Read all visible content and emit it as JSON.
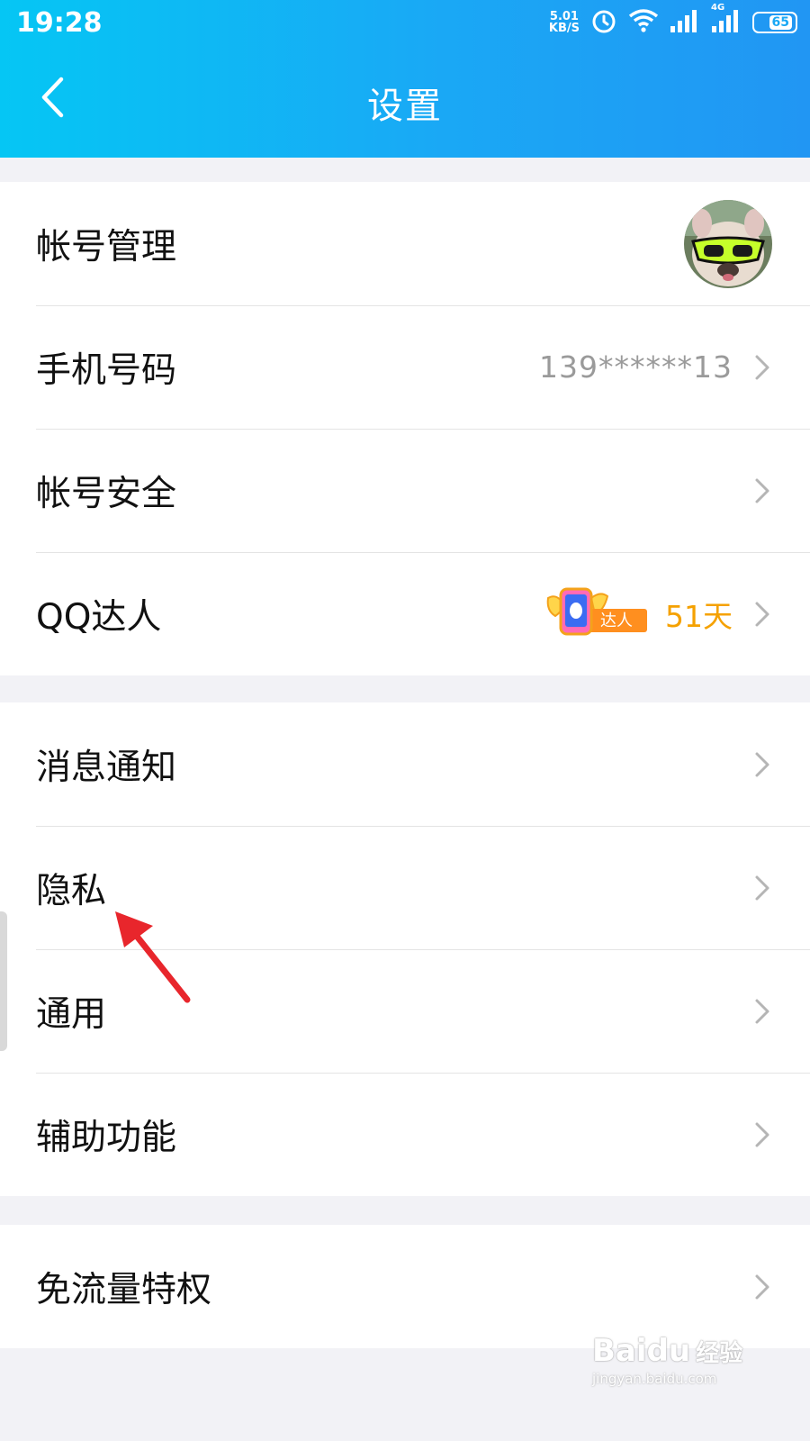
{
  "status_bar": {
    "time": "19:28",
    "net_speed_value": "5.01",
    "net_speed_unit": "KB/S",
    "network_type": "4G",
    "battery": "65"
  },
  "header": {
    "title": "设置",
    "back_icon": "chevron-left-icon"
  },
  "groups": [
    {
      "items": [
        {
          "label": "帐号管理",
          "avatar": "user-avatar"
        },
        {
          "label": "手机号码",
          "value": "139******13"
        },
        {
          "label": "帐号安全"
        },
        {
          "label": "QQ达人",
          "badge": "达人",
          "days": "51天"
        }
      ]
    },
    {
      "items": [
        {
          "label": "消息通知"
        },
        {
          "label": "隐私"
        },
        {
          "label": "通用"
        },
        {
          "label": "辅助功能"
        }
      ]
    },
    {
      "items": [
        {
          "label": "免流量特权"
        }
      ]
    }
  ],
  "annotation": {
    "arrow_color": "#e8262c",
    "points_to": "隐私"
  },
  "watermark": {
    "logo": "Baidu",
    "logo_cn": "经验",
    "url": "jingyan.baidu.com"
  },
  "colors": {
    "header_start": "#05c6f4",
    "header_end": "#2196f3",
    "background": "#f2f2f6",
    "value_gray": "#9a9a9a",
    "daren_orange": "#f5a100"
  }
}
